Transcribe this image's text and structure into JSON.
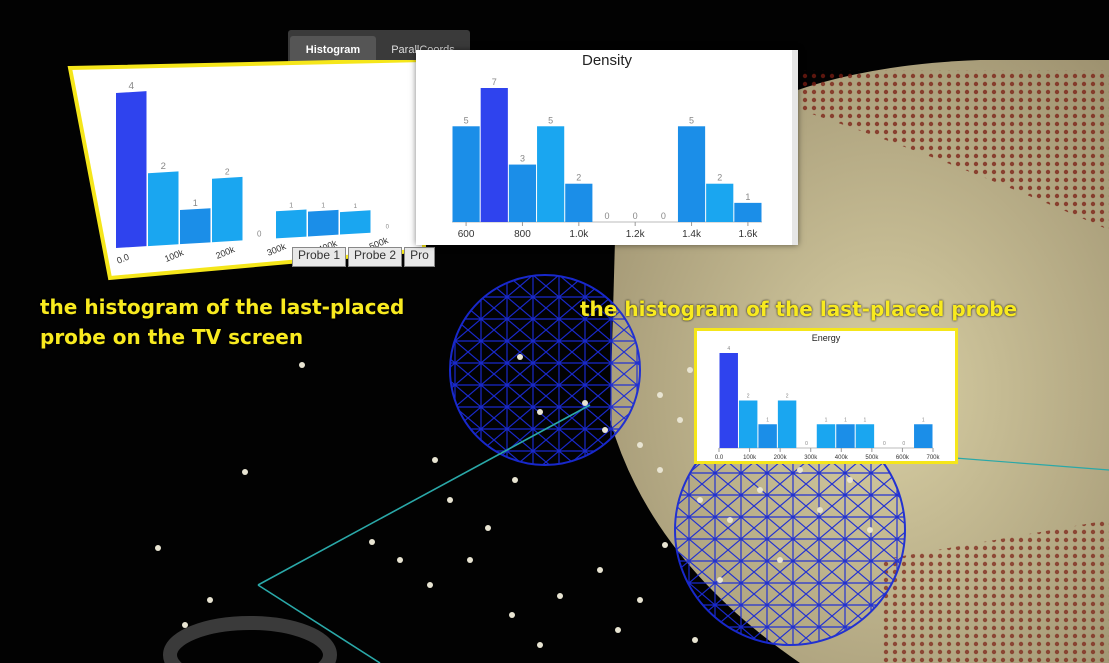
{
  "tabs": [
    {
      "label": "Histogram",
      "active": true
    },
    {
      "label": "ParallCoords",
      "active": false
    }
  ],
  "probes": [
    "Probe 1",
    "Probe 2",
    "Pro"
  ],
  "captions": {
    "left": "the histogram of the last-placed probe on the TV screen",
    "right": "the histogram of the last-placed probe"
  },
  "colors": {
    "highlight": "#f5e61a",
    "bar_dark": "#2f43ee",
    "bar_mid": "#1b8ee8",
    "bar_light": "#1aa6f0",
    "sphere_mesh": "#1a2bd6",
    "volume": "#c9bf92",
    "probe_line": "#2aa8a8"
  },
  "chart_data": [
    {
      "id": "tv-histogram",
      "type": "bar",
      "title": "",
      "x_ticks": [
        "0.0",
        "100k",
        "200k",
        "300k",
        "400k",
        "500k"
      ],
      "values": [
        4,
        2,
        1,
        2,
        0,
        1,
        1,
        1,
        0
      ],
      "value_labels": [
        "4",
        "2",
        "1",
        "2",
        "0",
        "1",
        "1",
        "1",
        "0"
      ],
      "ylim": [
        0,
        4
      ]
    },
    {
      "id": "density",
      "type": "bar",
      "title": "Density",
      "x_ticks": [
        "600",
        "800",
        "1.0k",
        "1.2k",
        "1.4k",
        "1.6k"
      ],
      "x": [
        560,
        620,
        680,
        740,
        800,
        860,
        920,
        980,
        1040,
        1100,
        1160
      ],
      "values": [
        5,
        7,
        3,
        5,
        2,
        0,
        0,
        0,
        5,
        2,
        1
      ],
      "value_labels": [
        "5",
        "7",
        "3",
        "5",
        "2",
        "0",
        "0",
        "0",
        "5",
        "2",
        "1"
      ],
      "ylim": [
        0,
        7
      ]
    },
    {
      "id": "energy",
      "type": "bar",
      "title": "Energy",
      "x_ticks": [
        "0.0",
        "100k",
        "200k",
        "300k",
        "400k",
        "500k",
        "600k",
        "700k"
      ],
      "values": [
        4,
        2,
        1,
        2,
        0,
        1,
        1,
        1,
        0,
        0,
        1
      ],
      "value_labels": [
        "4",
        "2",
        "1",
        "2",
        "0",
        "1",
        "1",
        "1",
        "0",
        "0",
        "1"
      ],
      "ylim": [
        0,
        4
      ]
    }
  ]
}
